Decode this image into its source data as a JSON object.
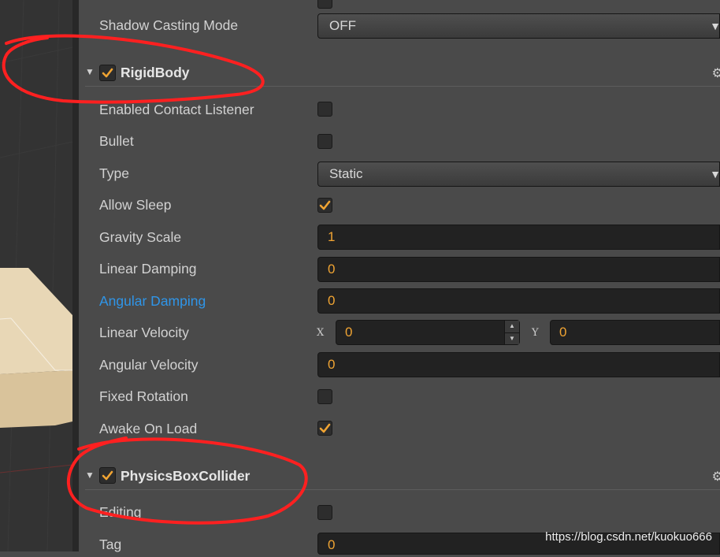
{
  "rows_top": {
    "shadow_casting_label": "Shadow Casting Mode",
    "shadow_casting_value": "OFF"
  },
  "rigidbody": {
    "title": "RigidBody",
    "enabled": true,
    "fields": {
      "enabled_contact_listener": {
        "label": "Enabled Contact Listener",
        "checked": false
      },
      "bullet": {
        "label": "Bullet",
        "checked": false
      },
      "type": {
        "label": "Type",
        "value": "Static"
      },
      "allow_sleep": {
        "label": "Allow Sleep",
        "checked": true
      },
      "gravity_scale": {
        "label": "Gravity Scale",
        "value": "1"
      },
      "linear_damping": {
        "label": "Linear Damping",
        "value": "0"
      },
      "angular_damping": {
        "label": "Angular Damping",
        "value": "0"
      },
      "linear_velocity": {
        "label": "Linear Velocity",
        "x_label": "X",
        "x": "0",
        "y_label": "Y",
        "y": "0"
      },
      "angular_velocity": {
        "label": "Angular Velocity",
        "value": "0"
      },
      "fixed_rotation": {
        "label": "Fixed Rotation",
        "checked": false
      },
      "awake_on_load": {
        "label": "Awake On Load",
        "checked": true
      }
    }
  },
  "box_collider": {
    "title": "PhysicsBoxCollider",
    "enabled": true,
    "fields": {
      "editing": {
        "label": "Editing",
        "checked": false
      },
      "tag": {
        "label": "Tag",
        "value": "0"
      }
    }
  },
  "watermark": "https://blog.csdn.net/kuokuo666",
  "colors": {
    "accent": "#f0a433",
    "highlight_label": "#2f95e8",
    "annotation": "#ff2020"
  }
}
